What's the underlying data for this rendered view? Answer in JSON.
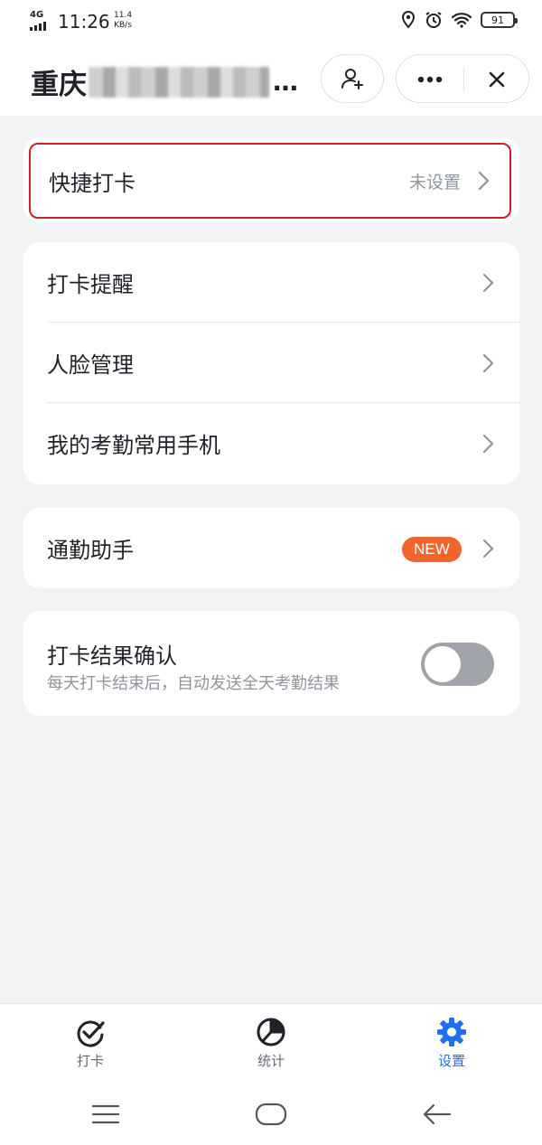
{
  "status_bar": {
    "network": "4G",
    "time": "11:26",
    "speed_value": "11.4",
    "speed_unit": "KB/s",
    "battery": "91",
    "icons": [
      "location-icon",
      "alarm-icon",
      "wifi-icon",
      "battery-icon"
    ]
  },
  "header": {
    "title_visible": "重庆",
    "title_ellipsis": "…",
    "buttons": [
      "add-person-icon",
      "more-icon",
      "close-icon"
    ]
  },
  "quick_punch": {
    "label": "快捷打卡",
    "value": "未设置"
  },
  "settings_group": [
    {
      "label": "打卡提醒"
    },
    {
      "label": "人脸管理"
    },
    {
      "label": "我的考勤常用手机"
    }
  ],
  "commute": {
    "label": "通勤助手",
    "badge": "NEW"
  },
  "result_confirm": {
    "label": "打卡结果确认",
    "description": "每天打卡结束后，自动发送全天考勤结果",
    "enabled": false
  },
  "tabbar": {
    "tabs": [
      {
        "label": "打卡",
        "icon": "check-badge-icon",
        "active": false
      },
      {
        "label": "统计",
        "icon": "pie-chart-icon",
        "active": false
      },
      {
        "label": "设置",
        "icon": "gear-icon",
        "active": true
      }
    ],
    "active_color": "#1f6ff2"
  },
  "colors": {
    "highlight_border": "#c8202b",
    "badge": "#f2642c",
    "background": "#f2f3f5"
  }
}
